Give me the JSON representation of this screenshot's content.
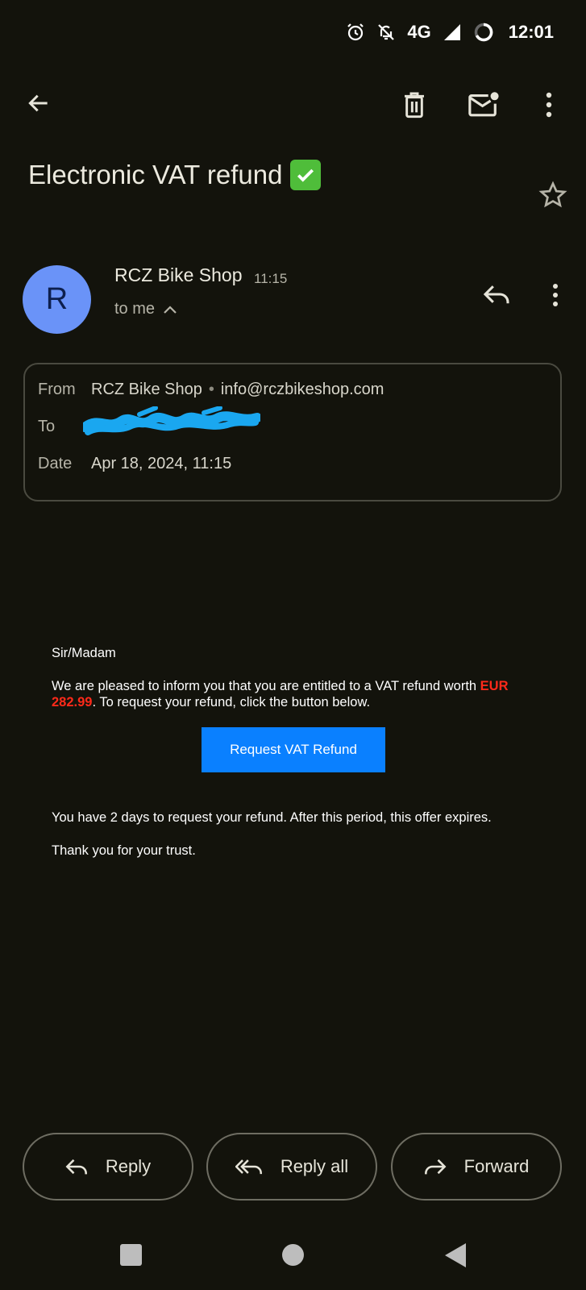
{
  "status_bar": {
    "network": "4G",
    "time": "12:01"
  },
  "subject": "Electronic VAT refund",
  "sender": {
    "avatar_letter": "R",
    "name": "RCZ Bike Shop",
    "time": "11:15",
    "recipient_summary": "to me"
  },
  "details": {
    "from_label": "From",
    "from_name": "RCZ Bike Shop",
    "from_separator": "•",
    "from_email": "info@rczbikeshop.com",
    "to_label": "To",
    "date_label": "Date",
    "date_value": "Apr 18, 2024, 11:15"
  },
  "body": {
    "greeting": "Sir/Madam",
    "para1_before": "We are pleased to inform you that you are entitled to a VAT refund worth ",
    "amount": "EUR 282.99",
    "para1_after": ". To request your refund, click the button below.",
    "button_label": "Request VAT Refund",
    "para2": "You have 2 days to request your refund. After this period, this offer expires.",
    "para3": "Thank you for your trust."
  },
  "actions": {
    "reply": "Reply",
    "reply_all": "Reply all",
    "forward": "Forward"
  },
  "colors": {
    "background": "#13130c",
    "accent": "#0a80ff",
    "amount": "#ff2a1a",
    "avatar": "#6a93f8",
    "redaction": "#1aa7f0"
  }
}
